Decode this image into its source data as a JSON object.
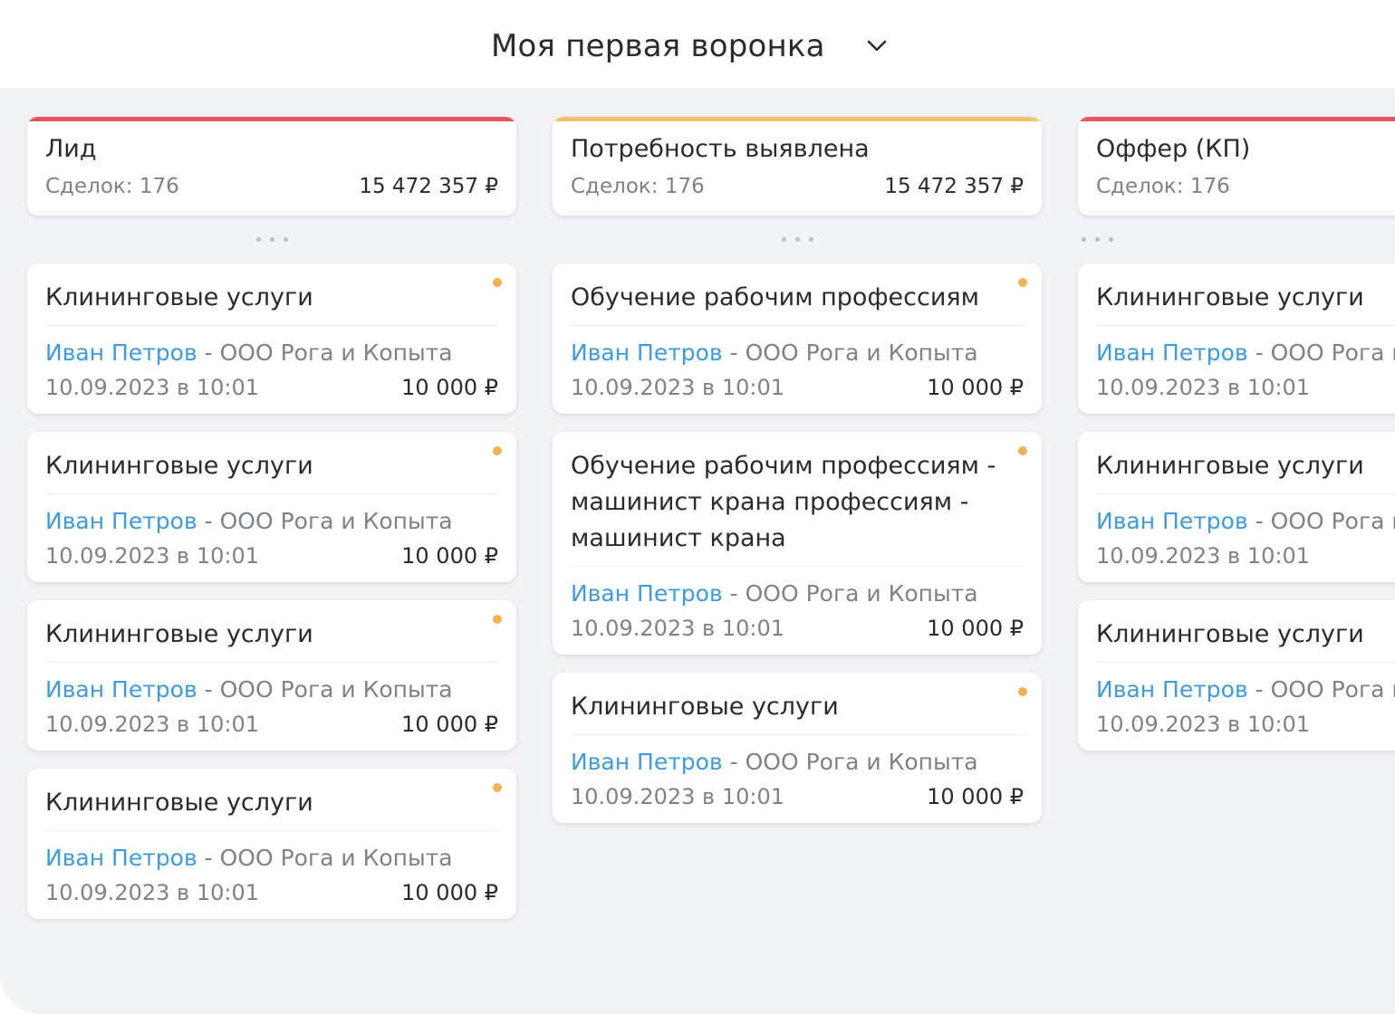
{
  "header": {
    "funnel_title": "Моя первая воронка",
    "chevron_icon": "chevron-down-icon"
  },
  "colors": {
    "red": "#e9545f",
    "orange": "#f6c36a",
    "link": "#3b9be6",
    "status_dot": "#f3b24f"
  },
  "columns": [
    {
      "name": "Лид",
      "count_label": "Сделок: 176",
      "sum": "15 472 357 ₽",
      "bar_color": "#e9545f",
      "cards": [
        {
          "title": "Клининговые услуги",
          "contact": "Иван Петров",
          "sep": " - ",
          "company": "ООО Рога и Копыта",
          "date": "10.09.2023 в 10:01",
          "amount": "10 000 ₽"
        },
        {
          "title": "Клининговые услуги",
          "contact": "Иван Петров",
          "sep": " - ",
          "company": "ООО Рога и Копыта",
          "date": "10.09.2023 в 10:01",
          "amount": "10 000 ₽"
        },
        {
          "title": "Клининговые услуги",
          "contact": "Иван Петров",
          "sep": " - ",
          "company": "ООО Рога и Копыта",
          "date": "10.09.2023 в 10:01",
          "amount": "10 000 ₽"
        },
        {
          "title": "Клининговые услуги",
          "contact": "Иван Петров",
          "sep": " - ",
          "company": "ООО Рога и Копыта",
          "date": "10.09.2023 в 10:01",
          "amount": "10 000 ₽"
        }
      ]
    },
    {
      "name": "Потребность выявлена",
      "count_label": "Сделок: 176",
      "sum": "15 472 357 ₽",
      "bar_color": "#f6c36a",
      "cards": [
        {
          "title": "Обучение рабочим профессиям",
          "contact": "Иван Петров",
          "sep": " - ",
          "company": "ООО Рога и Копыта",
          "date": "10.09.2023 в 10:01",
          "amount": "10 000 ₽"
        },
        {
          "title": "Обучение рабочим профессиям -\nмашинист крана  профессиям -\nмашинист крана",
          "contact": "Иван Петров",
          "sep": " - ",
          "company": "ООО Рога и Копыта",
          "date": "10.09.2023 в 10:01",
          "amount": "10 000 ₽"
        },
        {
          "title": "Клининговые услуги",
          "contact": "Иван Петров",
          "sep": " - ",
          "company": "ООО Рога и Копыта",
          "date": "10.09.2023 в 10:01",
          "amount": "10 000 ₽"
        }
      ]
    },
    {
      "name": "Оффер (КП)",
      "count_label": "Сделок: 176",
      "sum": "",
      "bar_color": "#e9545f",
      "cards": [
        {
          "title": "Клининговые услуги",
          "contact": "Иван Петров",
          "sep": " - ",
          "company": "ООО Рога и",
          "date": "10.09.2023 в 10:01",
          "amount": ""
        },
        {
          "title": "Клининговые услуги",
          "contact": "Иван Петров",
          "sep": " - ",
          "company": "ООО Рога и",
          "date": "10.09.2023 в 10:01",
          "amount": ""
        },
        {
          "title": "Клининговые услуги",
          "contact": "Иван Петров",
          "sep": " - ",
          "company": "ООО Рога и",
          "date": "10.09.2023 в 10:01",
          "amount": ""
        }
      ]
    }
  ]
}
